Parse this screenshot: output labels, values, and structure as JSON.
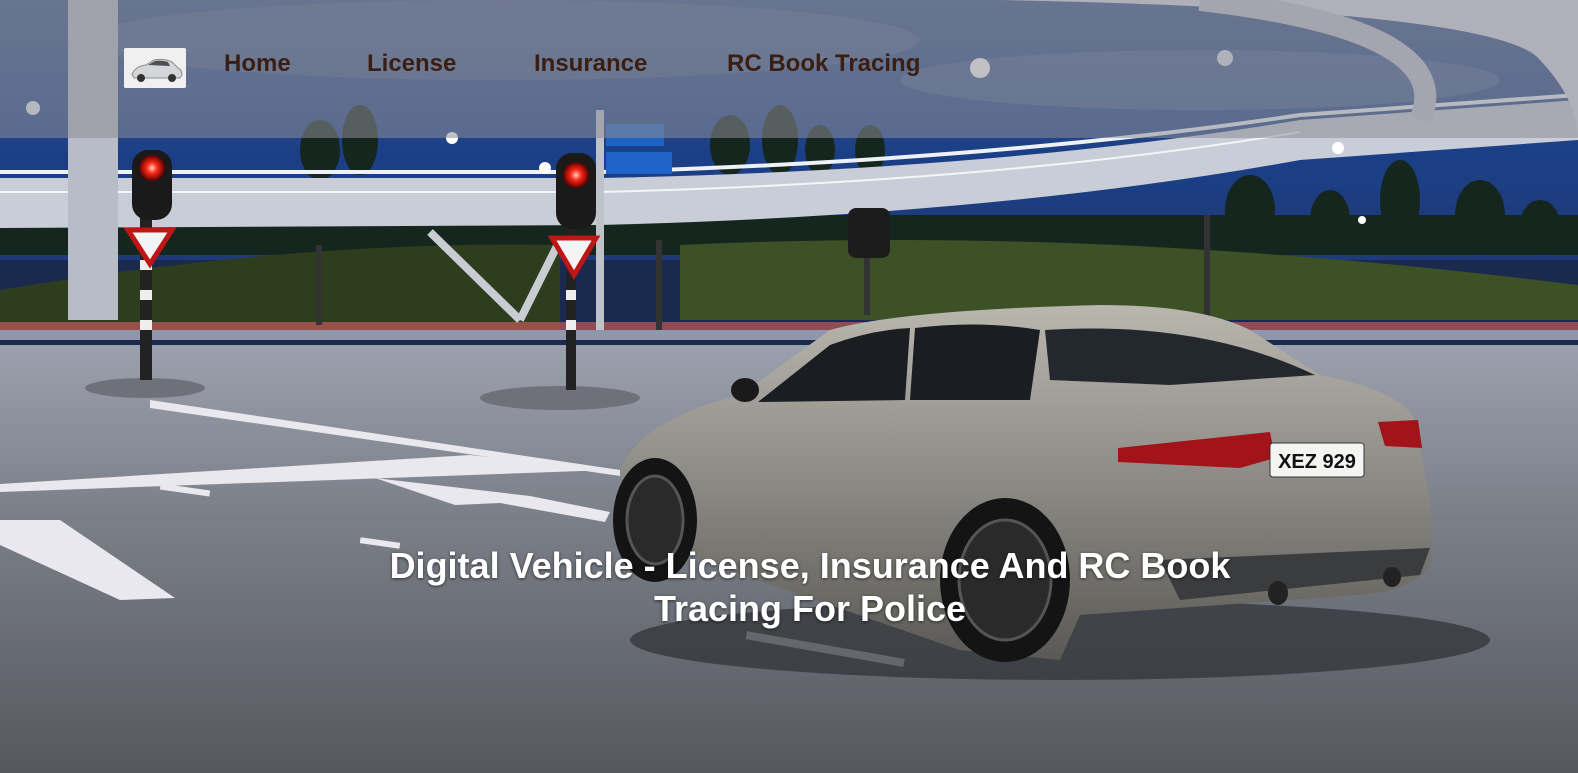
{
  "nav": {
    "logo_alt": "car-logo",
    "items": [
      {
        "label": "Home"
      },
      {
        "label": "License"
      },
      {
        "label": "Insurance"
      },
      {
        "label": "RC Book Tracing"
      }
    ]
  },
  "hero": {
    "title_line1": "Digital Vehicle - License, Insurance And RC Book",
    "title_line2": "Tracing For Police",
    "plate": "XEZ 929"
  },
  "colors": {
    "nav_text": "#3a1e12",
    "nav_bg": "rgba(140,140,150,0.55)",
    "hero_text": "#ffffff"
  }
}
